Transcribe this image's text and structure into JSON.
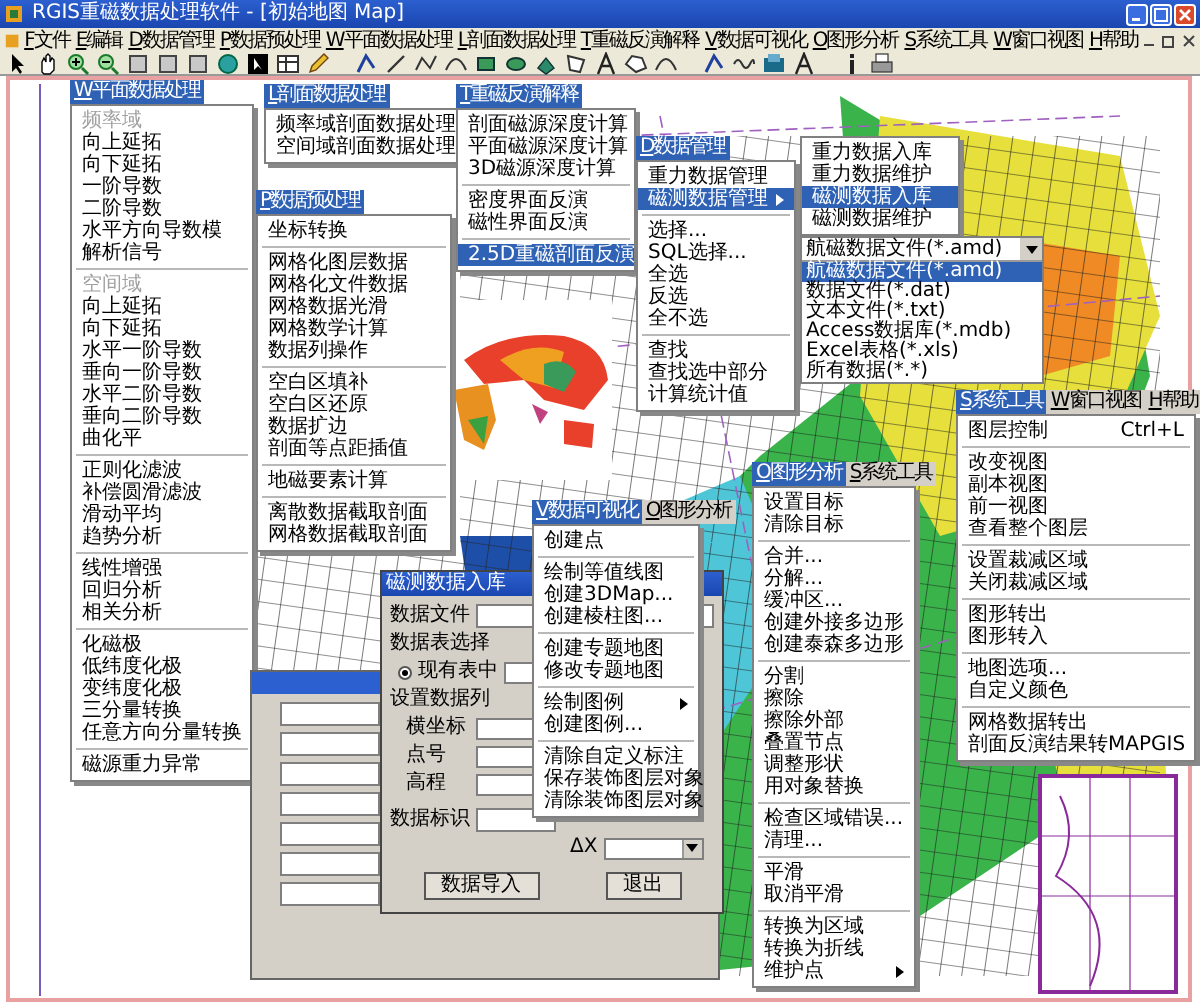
{
  "window": {
    "title": "RGIS重磁数据处理软件 - [初始地图 Map]"
  },
  "menu_bar": [
    {
      "key": "F",
      "label": "文件"
    },
    {
      "key": "E",
      "label": "编辑"
    },
    {
      "key": "D",
      "label": "数据管理"
    },
    {
      "key": "P",
      "label": "数据预处理"
    },
    {
      "key": "W",
      "label": "平面数据处理"
    },
    {
      "key": "L",
      "label": "剖面数据处理"
    },
    {
      "key": "T",
      "label": "重磁反演解释"
    },
    {
      "key": "V",
      "label": "数据可视化"
    },
    {
      "key": "O",
      "label": "图形分析"
    },
    {
      "key": "S",
      "label": "系统工具"
    },
    {
      "key": "W",
      "label": "窗口视图"
    },
    {
      "key": "H",
      "label": "帮助"
    }
  ],
  "menus": [
    {
      "tabs": [
        {
          "key": "W",
          "label": "平面数据处理",
          "selected": true
        }
      ],
      "items": [
        {
          "kind": "caption",
          "label": "频率域"
        },
        {
          "kind": "item",
          "label": "向上延拓",
          "selected": false
        },
        {
          "kind": "item",
          "label": "向下延拓",
          "selected": false
        },
        {
          "kind": "item",
          "label": "一阶导数",
          "selected": false
        },
        {
          "kind": "item",
          "label": "二阶导数",
          "selected": false
        },
        {
          "kind": "item",
          "label": "水平方向导数模",
          "selected": false
        },
        {
          "kind": "item",
          "label": "解析信号",
          "selected": false
        },
        {
          "kind": "separator"
        },
        {
          "kind": "caption",
          "label": "空间域"
        },
        {
          "kind": "item",
          "label": "向上延拓",
          "selected": false
        },
        {
          "kind": "item",
          "label": "向下延拓",
          "selected": false
        },
        {
          "kind": "item",
          "label": "水平一阶导数",
          "selected": false
        },
        {
          "kind": "item",
          "label": "垂向一阶导数",
          "selected": false
        },
        {
          "kind": "item",
          "label": "水平二阶导数",
          "selected": false
        },
        {
          "kind": "item",
          "label": "垂向二阶导数",
          "selected": false
        },
        {
          "kind": "item",
          "label": "曲化平",
          "selected": false
        },
        {
          "kind": "separator"
        },
        {
          "kind": "item",
          "label": "正则化滤波",
          "selected": false
        },
        {
          "kind": "item",
          "label": "补偿圆滑滤波",
          "selected": false
        },
        {
          "kind": "item",
          "label": "滑动平均",
          "selected": false
        },
        {
          "kind": "item",
          "label": "趋势分析",
          "selected": false
        },
        {
          "kind": "separator"
        },
        {
          "kind": "item",
          "label": "线性增强",
          "selected": false
        },
        {
          "kind": "item",
          "label": "回归分析",
          "selected": false
        },
        {
          "kind": "item",
          "label": "相关分析",
          "selected": false
        },
        {
          "kind": "separator"
        },
        {
          "kind": "item",
          "label": "化磁极",
          "selected": false
        },
        {
          "kind": "item",
          "label": "低纬度化极",
          "selected": false
        },
        {
          "kind": "item",
          "label": "变纬度化极",
          "selected": false
        },
        {
          "kind": "item",
          "label": "三分量转换",
          "selected": false
        },
        {
          "kind": "item",
          "label": "任意方向分量转换",
          "selected": false
        },
        {
          "kind": "separator"
        },
        {
          "kind": "item",
          "label": "磁源重力异常",
          "selected": false
        }
      ]
    },
    {
      "tabs": [
        {
          "key": "L",
          "label": "剖面数据处理",
          "selected": true
        }
      ],
      "items": [
        {
          "kind": "item",
          "label": "频率域剖面数据处理",
          "selected": false
        },
        {
          "kind": "item",
          "label": "空间域剖面数据处理",
          "selected": false
        }
      ]
    },
    {
      "tabs": [
        {
          "key": "P",
          "label": "数据预处理",
          "selected": true
        }
      ],
      "items": [
        {
          "kind": "item",
          "label": "坐标转换",
          "selected": false
        },
        {
          "kind": "separator"
        },
        {
          "kind": "item",
          "label": "网格化图层数据",
          "selected": false
        },
        {
          "kind": "item",
          "label": "网格化文件数据",
          "selected": false
        },
        {
          "kind": "item",
          "label": "网格数据光滑",
          "selected": false
        },
        {
          "kind": "item",
          "label": "网格数学计算",
          "selected": false
        },
        {
          "kind": "item",
          "label": "数据列操作",
          "selected": false
        },
        {
          "kind": "separator"
        },
        {
          "kind": "item",
          "label": "空白区填补",
          "selected": false
        },
        {
          "kind": "item",
          "label": "空白区还原",
          "selected": false
        },
        {
          "kind": "item",
          "label": "数据扩边",
          "selected": false
        },
        {
          "kind": "item",
          "label": "剖面等点距插值",
          "selected": false
        },
        {
          "kind": "separator"
        },
        {
          "kind": "item",
          "label": "地磁要素计算",
          "selected": false
        },
        {
          "kind": "separator"
        },
        {
          "kind": "item",
          "label": "离散数据截取剖面",
          "selected": false
        },
        {
          "kind": "item",
          "label": "网格数据截取剖面",
          "selected": false
        }
      ]
    },
    {
      "tabs": [
        {
          "key": "T",
          "label": "重磁反演解释",
          "selected": true
        }
      ],
      "items": [
        {
          "kind": "item",
          "label": "剖面磁源深度计算",
          "selected": false
        },
        {
          "kind": "item",
          "label": "平面磁源深度计算",
          "selected": false
        },
        {
          "kind": "item",
          "label": "3D磁源深度计算",
          "selected": false
        },
        {
          "kind": "separator"
        },
        {
          "kind": "item",
          "label": "密度界面反演",
          "selected": false
        },
        {
          "kind": "item",
          "label": "磁性界面反演",
          "selected": false
        },
        {
          "kind": "separator"
        },
        {
          "kind": "item",
          "label": "2.5D重磁剖面反演",
          "selected": true
        }
      ]
    },
    {
      "tabs": [
        {
          "key": "D",
          "label": "数据管理",
          "selected": true
        }
      ],
      "items": [
        {
          "kind": "item",
          "label": "重力数据管理",
          "selected": false
        },
        {
          "kind": "item",
          "label": "磁测数据管理",
          "selected": true,
          "has_submenu": true
        },
        {
          "kind": "separator"
        },
        {
          "kind": "item",
          "label": "选择...",
          "selected": false
        },
        {
          "kind": "item",
          "label": "SQL选择...",
          "selected": false
        },
        {
          "kind": "item",
          "label": "全选",
          "selected": false
        },
        {
          "kind": "item",
          "label": "反选",
          "selected": false
        },
        {
          "kind": "item",
          "label": "全不选",
          "selected": false
        },
        {
          "kind": "separator"
        },
        {
          "kind": "item",
          "label": "查找",
          "selected": false
        },
        {
          "kind": "item",
          "label": "查找选中部分",
          "selected": false
        },
        {
          "kind": "item",
          "label": "计算统计值",
          "selected": false
        }
      ]
    },
    {
      "items": [
        {
          "kind": "item",
          "label": "重力数据入库",
          "selected": false
        },
        {
          "kind": "item",
          "label": "重力数据维护",
          "selected": false
        },
        {
          "kind": "item",
          "label": "磁测数据入库",
          "selected": true
        },
        {
          "kind": "item",
          "label": "磁测数据维护",
          "selected": false
        }
      ]
    },
    {
      "tabs": [
        {
          "key": "V",
          "label": "数据可视化",
          "selected": true
        },
        {
          "key": "O",
          "label": "图形分析",
          "selected": false
        }
      ],
      "items": [
        {
          "kind": "item",
          "label": "创建点",
          "selected": false
        },
        {
          "kind": "separator"
        },
        {
          "kind": "item",
          "label": "绘制等值线图",
          "selected": false
        },
        {
          "kind": "item",
          "label": "创建3DMap...",
          "selected": false
        },
        {
          "kind": "item",
          "label": "创建棱柱图...",
          "selected": false
        },
        {
          "kind": "separator"
        },
        {
          "kind": "item",
          "label": "创建专题地图",
          "selected": false
        },
        {
          "kind": "item",
          "label": "修改专题地图",
          "selected": false
        },
        {
          "kind": "separator"
        },
        {
          "kind": "item",
          "label": "绘制图例",
          "selected": false,
          "has_submenu": true
        },
        {
          "kind": "item",
          "label": "创建图例...",
          "selected": false
        },
        {
          "kind": "separator"
        },
        {
          "kind": "item",
          "label": "清除自定义标注",
          "selected": false
        },
        {
          "kind": "item",
          "label": "保存装饰图层对象",
          "selected": false
        },
        {
          "kind": "item",
          "label": "清除装饰图层对象",
          "selected": false
        }
      ]
    },
    {
      "tabs": [
        {
          "key": "O",
          "label": "图形分析",
          "selected": true
        },
        {
          "key": "S",
          "label": "系统工具",
          "selected": false
        }
      ],
      "items": [
        {
          "kind": "item",
          "label": "设置目标",
          "selected": false
        },
        {
          "kind": "item",
          "label": "清除目标",
          "selected": false
        },
        {
          "kind": "separator"
        },
        {
          "kind": "item",
          "label": "合并...",
          "selected": false
        },
        {
          "kind": "item",
          "label": "分解...",
          "selected": false
        },
        {
          "kind": "item",
          "label": "缓冲区...",
          "selected": false
        },
        {
          "kind": "item",
          "label": "创建外接多边形",
          "selected": false
        },
        {
          "kind": "item",
          "label": "创建泰森多边形",
          "selected": false
        },
        {
          "kind": "separator"
        },
        {
          "kind": "item",
          "label": "分割",
          "selected": false
        },
        {
          "kind": "item",
          "label": "擦除",
          "selected": false
        },
        {
          "kind": "item",
          "label": "擦除外部",
          "selected": false
        },
        {
          "kind": "item",
          "label": "叠置节点",
          "selected": false
        },
        {
          "kind": "item",
          "label": "调整形状",
          "selected": false
        },
        {
          "kind": "item",
          "label": "用对象替换",
          "selected": false
        },
        {
          "kind": "separator"
        },
        {
          "kind": "item",
          "label": "检查区域错误...",
          "selected": false
        },
        {
          "kind": "item",
          "label": "清理...",
          "selected": false
        },
        {
          "kind": "separator"
        },
        {
          "kind": "item",
          "label": "平滑",
          "selected": false
        },
        {
          "kind": "item",
          "label": "取消平滑",
          "selected": false
        },
        {
          "kind": "separator"
        },
        {
          "kind": "item",
          "label": "转换为区域",
          "selected": false
        },
        {
          "kind": "item",
          "label": "转换为折线",
          "selected": false
        },
        {
          "kind": "item",
          "label": "维护点",
          "selected": false,
          "has_submenu": true
        }
      ]
    },
    {
      "tabs": [
        {
          "key": "S",
          "label": "系统工具",
          "selected": true
        },
        {
          "key": "W",
          "label": "窗口视图",
          "selected": false
        },
        {
          "key": "H",
          "label": "帮助",
          "selected": false
        }
      ],
      "items": [
        {
          "kind": "item",
          "label": "图层控制",
          "shortcut": "Ctrl+L",
          "selected": false
        },
        {
          "kind": "separator"
        },
        {
          "kind": "item",
          "label": "改变视图",
          "selected": false
        },
        {
          "kind": "item",
          "label": "副本视图",
          "selected": false
        },
        {
          "kind": "item",
          "label": "前一视图",
          "selected": false
        },
        {
          "kind": "item",
          "label": "查看整个图层",
          "selected": false
        },
        {
          "kind": "separator"
        },
        {
          "kind": "item",
          "label": "设置裁减区域",
          "selected": false
        },
        {
          "kind": "item",
          "label": "关闭裁减区域",
          "selected": false
        },
        {
          "kind": "separator"
        },
        {
          "kind": "item",
          "label": "图形转出",
          "selected": false
        },
        {
          "kind": "item",
          "label": "图形转入",
          "selected": false
        },
        {
          "kind": "separator"
        },
        {
          "kind": "item",
          "label": "地图选项...",
          "selected": false
        },
        {
          "kind": "item",
          "label": "自定义颜色",
          "selected": false
        },
        {
          "kind": "separator"
        },
        {
          "kind": "item",
          "label": "网格数据转出",
          "selected": false
        },
        {
          "kind": "item",
          "label": "剖面反演结果转MAPGIS",
          "selected": false
        }
      ]
    }
  ],
  "file_type_combo": {
    "value": "航磁数据文件(*.amd)",
    "options": [
      {
        "label": "航磁数据文件(*.amd)",
        "selected": true
      },
      {
        "label": "数据文件(*.dat)",
        "selected": false
      },
      {
        "label": "文本文件(*.txt)",
        "selected": false
      },
      {
        "label": "Access数据库(*.mdb)",
        "selected": false
      },
      {
        "label": "Excel表格(*.xls)",
        "selected": false
      },
      {
        "label": "所有数据(*.*)",
        "selected": false
      }
    ]
  },
  "dialog": {
    "title": "磁测数据入库",
    "file_label": "数据文件",
    "table_group": "数据表选择",
    "table_option": {
      "label": "现有表中",
      "selected": true
    },
    "columns_group": "设置数据列",
    "column_fields": [
      "横坐标",
      "点号",
      "高程"
    ],
    "id_label": "数据标识",
    "dx_label": "ΔX",
    "buttons": [
      "数据导入",
      "退出"
    ]
  }
}
